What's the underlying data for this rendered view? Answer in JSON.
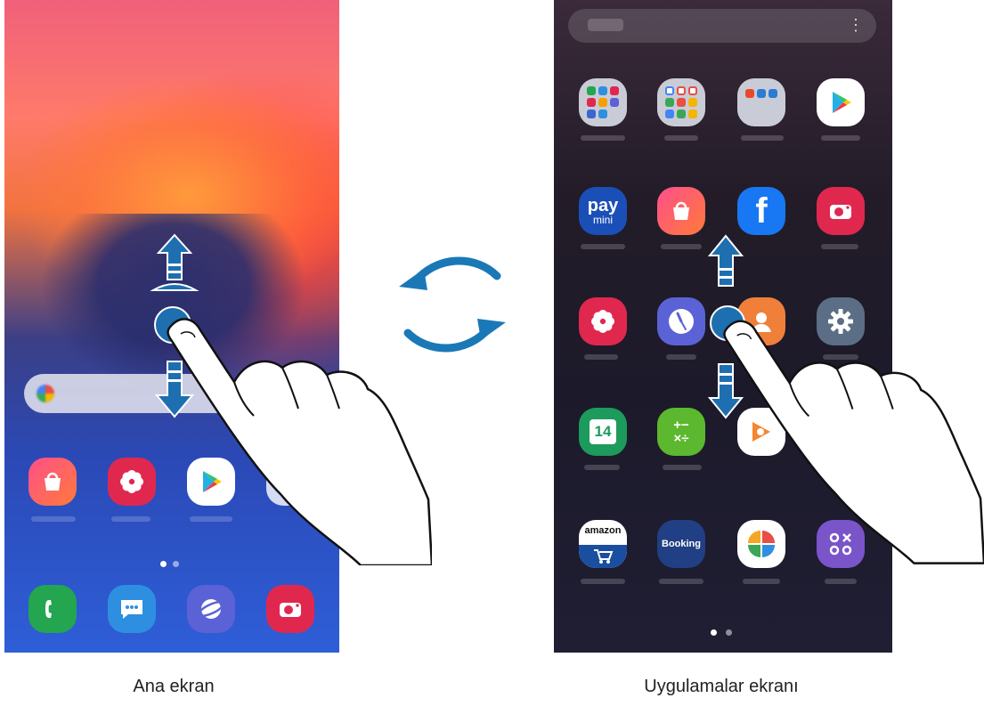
{
  "captions": {
    "home": "Ana ekran",
    "apps": "Uygulamalar ekranı"
  },
  "home_screen": {
    "row_apps": [
      "galaxy-store",
      "gallery",
      "play-store"
    ],
    "dock": [
      "phone",
      "messages",
      "internet",
      "camera"
    ],
    "page_dots": 2
  },
  "apps_screen": {
    "search_more": "⋮",
    "rows": [
      [
        "samsung-folder",
        "google-folder",
        "microsoft-folder",
        "play-store"
      ],
      [
        "samsung-pay-mini",
        "galaxy-store",
        "facebook",
        "camera"
      ],
      [
        "gallery",
        "clock",
        "contacts",
        "settings"
      ],
      [
        "calendar",
        "calculator",
        "play-music",
        ""
      ],
      [
        "amazon",
        "booking",
        "game-launcher",
        "smartthings"
      ]
    ],
    "icon_text": {
      "pay": "pay",
      "mini": "mini",
      "facebook": "f",
      "calendar": "14",
      "calculator": "+−\n×÷",
      "amazon": "amazon",
      "booking": "Booking"
    },
    "page_dots": 2
  },
  "colors": {
    "arrow": "#1e6fb0",
    "swipe_arrow": "#1b78b7"
  }
}
